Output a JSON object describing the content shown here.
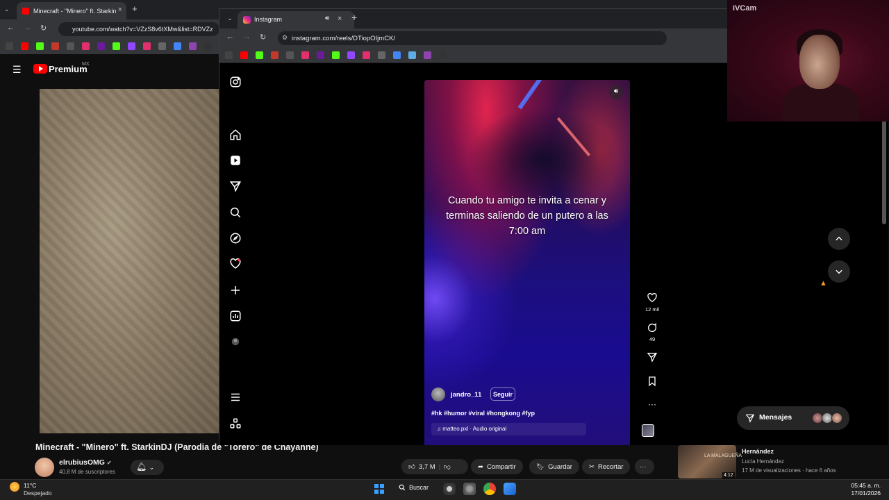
{
  "youtube": {
    "tab_title": "Minecraft - \"Minero\" ft. Starkin",
    "url": "youtube.com/watch?v=VZzS8v6tXMw&list=RDVZz",
    "logo_text": "Premium",
    "region": "MX",
    "video_title": "Minecraft - \"Minero\" ft. StarkinDJ (Parodia de \"Torero\" de Chayanne)",
    "channel_name": "elrubiusOMG",
    "subscribers": "40,8 M de suscriptores",
    "likes": "3,7 M",
    "share_label": "Compartir",
    "save_label": "Guardar",
    "clip_label": "Recortar",
    "more_label": "···",
    "recommendation": {
      "thumb_text": "LA MALAGUEÑA",
      "duration": "4:12",
      "title": "Hernández",
      "channel": "Lucía Hernández",
      "meta": "17 M de visualizaciones · hace 6 años"
    }
  },
  "instagram": {
    "tab_title": "Instagram",
    "url": "instagram.com/reels/DTiopOIjmCK/",
    "caption": "Cuando tu amigo te invita a cenar y terminas saliendo de un putero a las 7:00 am",
    "username": "jandro_11",
    "follow_label": "Seguir",
    "hashtags": "#hk #humor #viral #hongkong #fyp",
    "audio": "matteo.pxl · Audio original",
    "likes_count": "12 mil",
    "comments_count": "49",
    "messages_label": "Mensajes"
  },
  "webcam": {
    "title": "iVCam"
  },
  "taskbar": {
    "temperature": "11°C",
    "weather": "Despejado",
    "search_label": "Buscar",
    "time": "05:45 a. m.",
    "date": "17/01/2026"
  },
  "colors": {
    "instagram_bg": "#000000",
    "youtube_red": "#ff0000",
    "reel_purple": "#1c0f7e",
    "taskbar": "#202020"
  }
}
